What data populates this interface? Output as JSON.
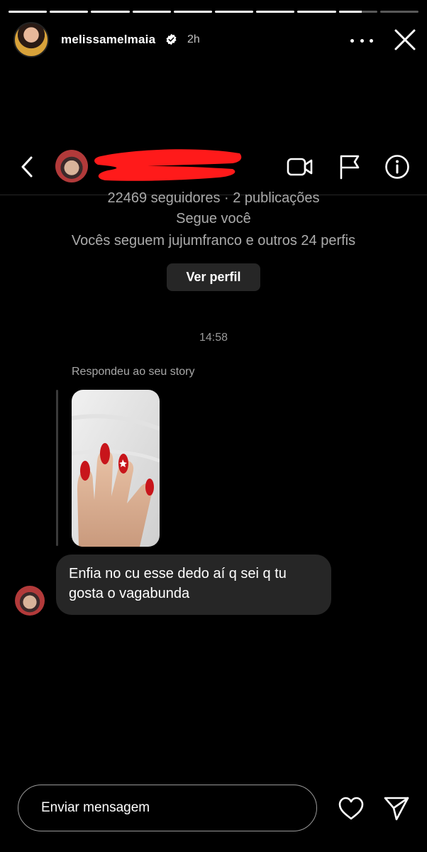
{
  "story": {
    "username": "melissamelmaia",
    "time": "2h",
    "progress": [
      1,
      1,
      1,
      1,
      1,
      1,
      1,
      1,
      0.6,
      0
    ],
    "verified": true
  },
  "icons": {
    "verified": "verified-badge-icon",
    "more": "more-icon",
    "close": "close-icon",
    "back": "chevron-left-icon",
    "video": "video-call-icon",
    "flag": "flag-icon",
    "info": "info-icon",
    "like": "heart-icon",
    "send": "send-icon"
  },
  "dm": {
    "stats": "22469 seguidores · 2 publicações",
    "follows_you": "Segue você",
    "mutual": "Vocês seguem jujumfranco e outros 24 perfis",
    "view_profile": "Ver perfil"
  },
  "thread": {
    "timestamp": "14:58",
    "reply_label": "Respondeu ao seu story",
    "message": "Enfia no cu esse dedo aí q sei q tu gosta o vagabunda"
  },
  "composer": {
    "placeholder": "Enviar mensagem"
  },
  "colors": {
    "background": "#000000",
    "bubble": "#262626",
    "button": "#262626",
    "redaction": "#ff1a1a",
    "nail": "#c8151b"
  }
}
